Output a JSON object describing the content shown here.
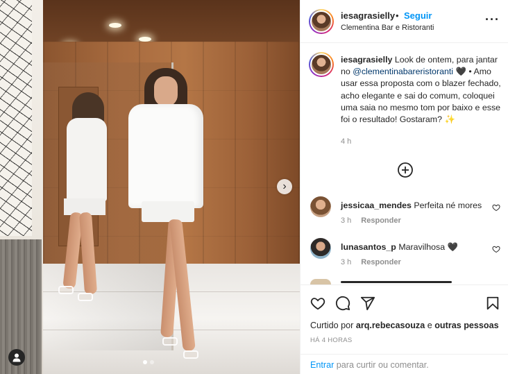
{
  "post": {
    "author": {
      "username": "iesagrasielly",
      "follow_label": "Seguir",
      "separator": "•",
      "location": "Clementina Bar e Ristoranti"
    },
    "caption": {
      "username": "iesagrasielly",
      "text_before_mention": " Look de ontem, para jantar no ",
      "mention": "@clementinabareristoranti",
      "text_after_mention": " 🖤 • Amo usar essa proposta com o blazer fechado, acho elegante e sai do comum, coloquei uma saia no mesmo tom por baixo e esse foi o resultado! Gostaram? ✨",
      "time": "4 h"
    },
    "carousel": {
      "current": 1,
      "total": 2
    },
    "comments": [
      {
        "username": "jessicaa_mendes",
        "text": " Perfeita né mores",
        "time": "3 h",
        "reply_label": "Responder"
      },
      {
        "username": "lunasantos_p",
        "text": " Maravilhosa 🖤",
        "time": "3 h",
        "reply_label": "Responder"
      }
    ],
    "likes": {
      "prefix": "Curtido por ",
      "user": "arq.rebecasouza",
      "suffix": " e ",
      "others": "outras pessoas"
    },
    "timestamp": "HÁ 4 HORAS",
    "login": {
      "link": "Entrar",
      "text": " para curtir ou comentar."
    }
  },
  "icons": {
    "more": "more-options-icon",
    "next": "chevron-right-icon",
    "tag": "user-tag-icon",
    "load_more": "plus-circle-icon",
    "like": "heart-icon",
    "comment": "comment-icon",
    "share": "send-icon",
    "save": "bookmark-icon"
  },
  "colors": {
    "link_blue": "#0095f6",
    "mention": "#00376b",
    "muted": "#8e8e8e",
    "text": "#262626"
  }
}
